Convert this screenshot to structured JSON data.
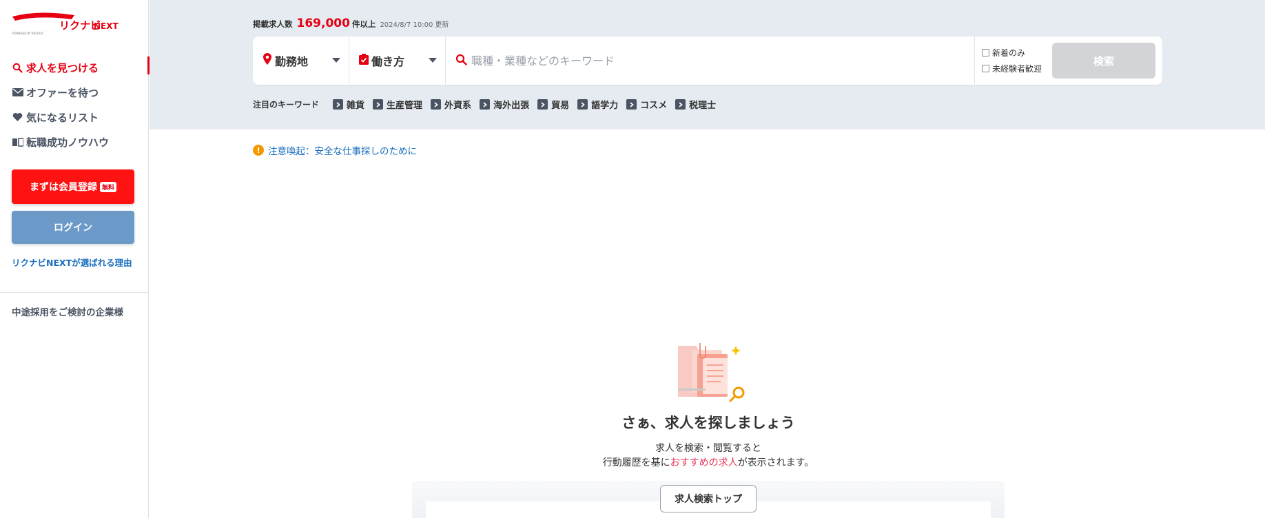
{
  "brand": {
    "logo_text": "リクナビNEXT",
    "logo_sub": "POWERED BY RECRUIT"
  },
  "sidebar": {
    "items": [
      {
        "label": "求人を見つける",
        "icon": "search-icon",
        "active": true
      },
      {
        "label": "オファーを待つ",
        "icon": "mail-icon",
        "active": false
      },
      {
        "label": "気になるリスト",
        "icon": "heart-icon",
        "active": false
      },
      {
        "label": "転職成功ノウハウ",
        "icon": "book-icon",
        "active": false
      }
    ],
    "register_label": "まずは会員登録",
    "register_badge": "無料",
    "login_label": "ログイン",
    "why_link": "リクナビNEXTが選ばれる理由",
    "corp_link": "中途採用をご検討の企業様"
  },
  "search": {
    "count_prefix": "掲載求人数",
    "count_value": "169,000",
    "count_suffix": "件以上",
    "updated": "2024/8/7 10:00 更新",
    "area_label": "勤務地",
    "work_label": "働き方",
    "keyword_placeholder": "職種・業種などのキーワード",
    "check_new": "新着のみ",
    "check_inexp": "未経験者歓迎",
    "button": "検索",
    "keywords_title": "注目のキーワード",
    "keywords": [
      "雑貨",
      "生産管理",
      "外資系",
      "海外出張",
      "貿易",
      "語学力",
      "コスメ",
      "税理士"
    ]
  },
  "alert": {
    "text": "注意喚起：安全な仕事探しのために"
  },
  "empty": {
    "title": "さぁ、求人を探しましょう",
    "line1": "求人を検索・閲覧すると",
    "line2_pre": "行動履歴を基に",
    "line2_hl": "おすすめの求人",
    "line2_post": "が表示されます。",
    "top_button": "求人検索トップ"
  },
  "colors": {
    "brand_red": "#e60012",
    "login_blue": "#6b9ac8",
    "link_blue": "#1a6fbf",
    "search_bg": "#e6ebf2"
  }
}
